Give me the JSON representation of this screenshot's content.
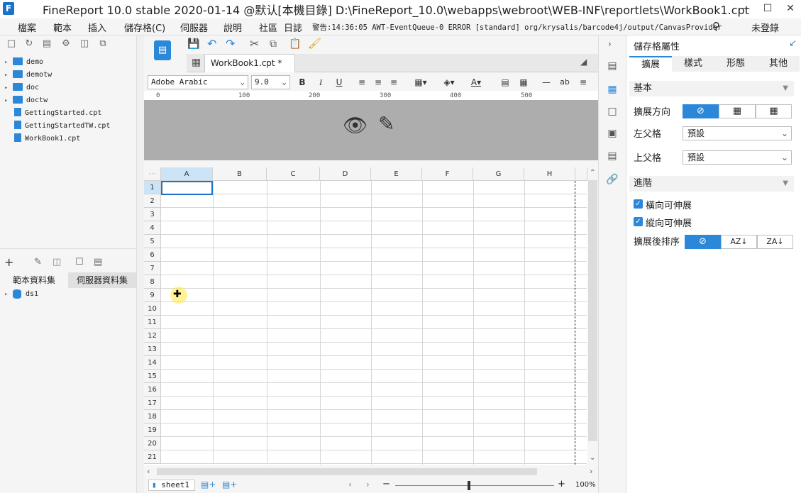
{
  "window": {
    "title": "FineReport 10.0 stable 2020-01-14 @默认[本機目錄]    D:\\FineReport_10.0\\webapps\\webroot\\WEB-INF\\reportlets\\WorkBook1.cpt",
    "min_label": "—",
    "max_label": "☐",
    "close_label": "✕"
  },
  "menu": {
    "items": [
      "檔案",
      "範本",
      "插入",
      "儲存格(C)",
      "伺服器",
      "說明",
      "社區",
      "日誌"
    ],
    "log_text": "警告:14:36:05 AWT-EventQueue-0 ERROR [standard] org/krysalis/barcode4j/output/CanvasProvider",
    "login_label": "未登錄"
  },
  "file_tree": {
    "items": [
      {
        "label": "demo",
        "type": "folder"
      },
      {
        "label": "demotw",
        "type": "folder"
      },
      {
        "label": "doc",
        "type": "folder"
      },
      {
        "label": "doctw",
        "type": "folder"
      },
      {
        "label": "GettingStarted.cpt",
        "type": "file"
      },
      {
        "label": "GettingStartedTW.cpt",
        "type": "file"
      },
      {
        "label": "WorkBook1.cpt",
        "type": "file"
      }
    ]
  },
  "dataset": {
    "tabs": [
      "範本資料集",
      "伺服器資料集"
    ],
    "items": [
      {
        "label": "ds1"
      }
    ]
  },
  "editor": {
    "tab_label": "WorkBook1.cpt *",
    "font_name": "Adobe Arabic",
    "font_size": "9.0",
    "ruler_ticks": [
      "0",
      "100",
      "200",
      "300",
      "400",
      "500"
    ],
    "columns": [
      "A",
      "B",
      "C",
      "D",
      "E",
      "F",
      "G",
      "H"
    ],
    "rows": [
      "1",
      "2",
      "3",
      "4",
      "5",
      "6",
      "7",
      "8",
      "9",
      "10",
      "11",
      "12",
      "13",
      "14",
      "15",
      "16",
      "17",
      "18",
      "19",
      "20",
      "21"
    ],
    "sheet_name": "sheet1",
    "zoom": "100%"
  },
  "properties": {
    "title": "儲存格屬性",
    "tabs": [
      "擴展",
      "樣式",
      "形態",
      "其他"
    ],
    "basic_section": "基本",
    "expand_direction_label": "擴展方向",
    "left_parent_label": "左父格",
    "left_parent_value": "預設",
    "top_parent_label": "上父格",
    "top_parent_value": "預設",
    "advanced_section": "進階",
    "horizontal_expand_label": "橫向可伸展",
    "vertical_expand_label": "縱向可伸展",
    "sort_label": "擴展後排序"
  },
  "colors": {
    "accent": "#2b88d8",
    "header_area": "#adadad"
  }
}
